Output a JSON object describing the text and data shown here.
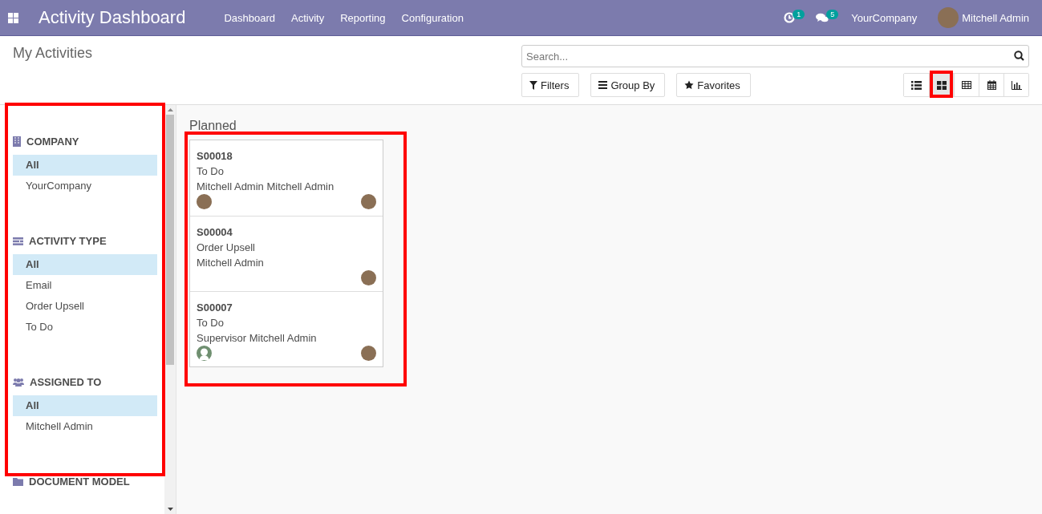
{
  "navbar": {
    "app_title": "Activity Dashboard",
    "menu": [
      "Dashboard",
      "Activity",
      "Reporting",
      "Configuration"
    ],
    "activity_count": "1",
    "message_count": "5",
    "company": "YourCompany",
    "user": "Mitchell Admin"
  },
  "control_panel": {
    "title": "My Activities",
    "search": {
      "placeholder": "Search..."
    },
    "buttons": [
      "Filters",
      "Group By",
      "Favorites"
    ],
    "views": [
      {
        "kind": "list",
        "selected": false
      },
      {
        "kind": "kanban",
        "selected": true
      },
      {
        "kind": "pivot",
        "selected": false
      },
      {
        "kind": "calendar",
        "selected": false
      },
      {
        "kind": "graph",
        "selected": false
      }
    ]
  },
  "sidebar": {
    "sections": [
      {
        "kind": "company",
        "title": "COMPANY",
        "items": [
          {
            "label": "All",
            "selected": true
          },
          {
            "label": "YourCompany",
            "selected": false
          }
        ]
      },
      {
        "kind": "activity_type",
        "title": "ACTIVITY TYPE",
        "items": [
          {
            "label": "All",
            "selected": true
          },
          {
            "label": "Email",
            "selected": false
          },
          {
            "label": "Order Upsell",
            "selected": false
          },
          {
            "label": "To Do",
            "selected": false
          }
        ]
      },
      {
        "kind": "assigned",
        "title": "ASSIGNED TO",
        "items": [
          {
            "label": "All",
            "selected": true
          },
          {
            "label": "Mitchell Admin",
            "selected": false
          }
        ]
      },
      {
        "kind": "document",
        "title": "DOCUMENT MODEL"
      }
    ]
  },
  "kanban": {
    "column_title": "Planned",
    "cards": [
      {
        "ref": "S00018",
        "type": "To Do",
        "people": "Mitchell Admin Mitchell Admin",
        "kind": "photo"
      },
      {
        "ref": "S00004",
        "type": "Order Upsell",
        "people": "Mitchell Admin",
        "kind": "none"
      },
      {
        "ref": "S00007",
        "type": "To Do",
        "people": "Supervisor Mitchell Admin",
        "kind": "placeholder"
      }
    ]
  }
}
